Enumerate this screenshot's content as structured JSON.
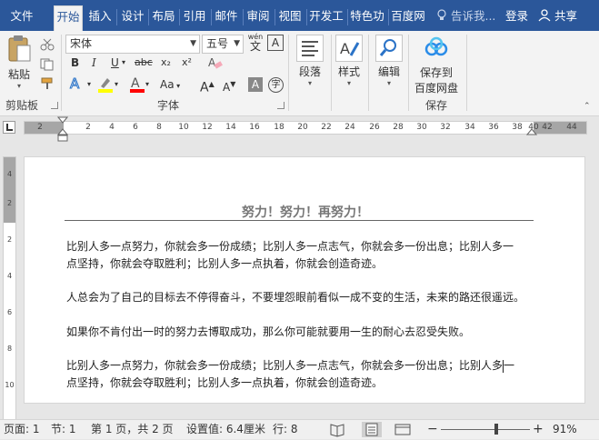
{
  "ribbon_tabs": {
    "file": "文件",
    "home": "开始",
    "insert": "插入",
    "design": "设计",
    "layout": "布局",
    "references": "引用",
    "mailings": "邮件",
    "review": "审阅",
    "view": "视图",
    "developer": "开发工",
    "tese": "特色功",
    "baidu": "百度网",
    "tell_me": "告诉我...",
    "login": "登录",
    "share": "共享"
  },
  "clipboard": {
    "paste": "粘贴",
    "group": "剪贴板"
  },
  "font": {
    "font_name": "宋体",
    "font_size": "五号",
    "group": "字体",
    "bold": "B",
    "italic": "I",
    "underline": "U",
    "strike": "abc",
    "subscript": "x₂",
    "superscript": "x²",
    "case": "Aa",
    "grow": "A",
    "shrink": "A",
    "wen": "wén"
  },
  "paragraph": {
    "label": "段落"
  },
  "styles": {
    "label": "样式"
  },
  "editing": {
    "label": "编辑"
  },
  "save_group": {
    "label_line1": "保存到",
    "label_line2": "百度网盘",
    "group": "保存"
  },
  "ruler": {
    "h_ticks": [
      "2",
      "2",
      "4",
      "6",
      "8",
      "10",
      "12",
      "14",
      "16",
      "18",
      "20",
      "22",
      "24",
      "26",
      "28",
      "30",
      "32",
      "34",
      "36",
      "38",
      "40",
      "42",
      "44"
    ],
    "v_ticks": [
      "4",
      "2",
      "2",
      "4",
      "6",
      "8",
      "10"
    ]
  },
  "document": {
    "title": "努力！努力！再努力！",
    "paragraphs": [
      [
        "比别人多一点努力，你就会多一份成绩；比别人多一点志气，你就会多一份出息；比别人多一",
        "点坚持，你就会夺取胜利；比别人多一点执着，你就会创造奇迹。"
      ],
      [
        "人总会为了自己的目标去不停得奋斗，不要埋怨眼前看似一成不变的生活，未来的路还很遥远。"
      ],
      [
        "如果你不肯付出一时的努力去博取成功，那么你可能就要用一生的耐心去忍受失败。"
      ],
      [
        "比别人多一点努力，你就会多一份成绩；比别人多一点志气，你就会多一份出息；比别人多",
        "点坚持，你就会夺取胜利；比别人多一点执着，你就会创造奇迹。"
      ]
    ],
    "last_line1_tail": "一"
  },
  "status": {
    "page": "页面: 1",
    "section": "节: 1",
    "page_of": "第 1 页，共 2 页",
    "setting": "设置值: 6.4厘米",
    "line": "行: 8",
    "minus": "−",
    "plus": "+",
    "zoom": "91%",
    "zoom_fraction": 0.62
  },
  "colors": {
    "accent": "#2b579a",
    "highlight": "#ffff00",
    "font_color": "#ff0000"
  }
}
